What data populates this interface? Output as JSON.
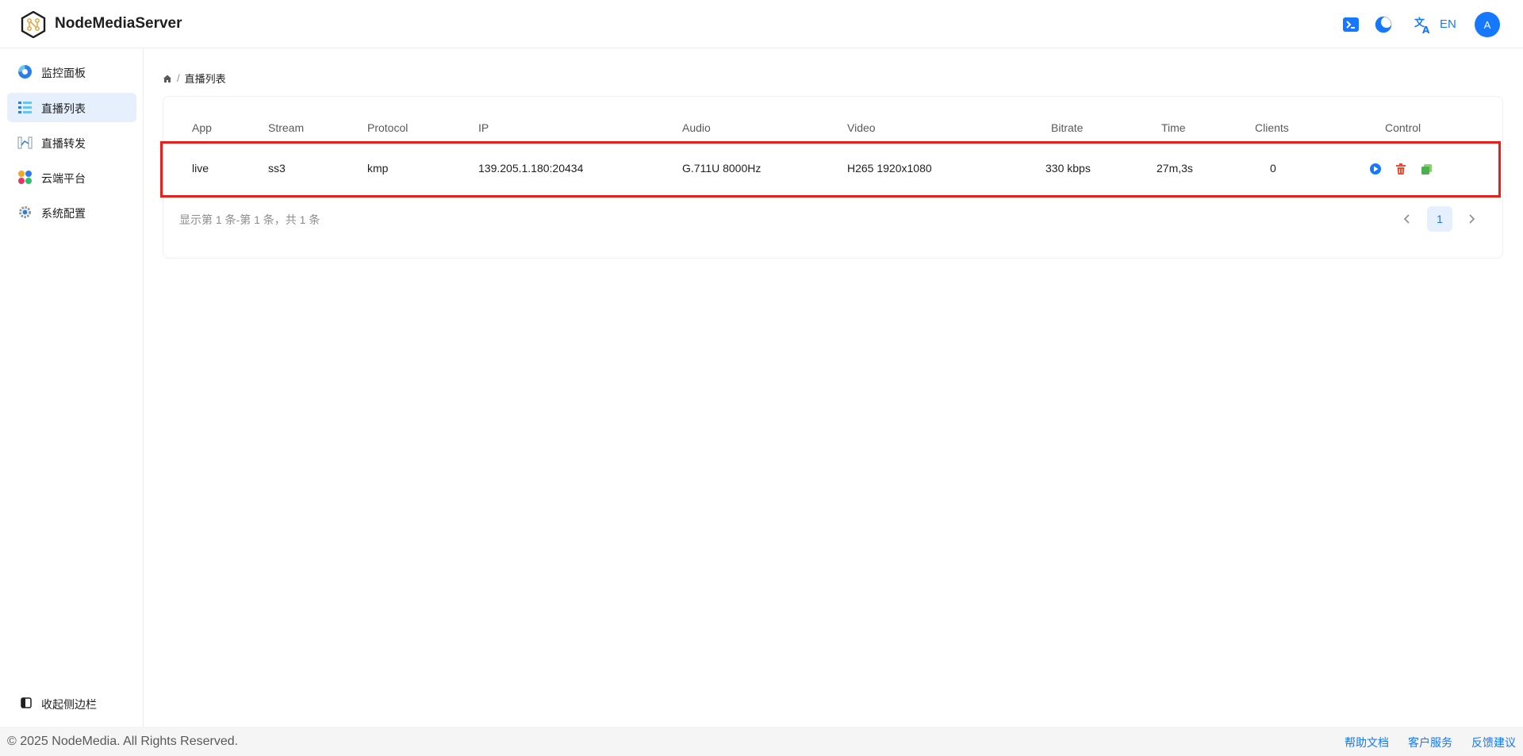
{
  "header": {
    "app_title": "NodeMediaServer",
    "lang": "EN",
    "avatar_initial": "A",
    "accent": "#1677ff"
  },
  "sidebar": {
    "items": [
      {
        "label": "监控面板",
        "icon": "dashboard-icon"
      },
      {
        "label": "直播列表",
        "icon": "list-icon",
        "active": true
      },
      {
        "label": "直播转发",
        "icon": "relay-icon"
      },
      {
        "label": "云端平台",
        "icon": "cloud-platform-icon"
      },
      {
        "label": "系统配置",
        "icon": "settings-icon"
      }
    ],
    "collapse_label": "收起侧边栏"
  },
  "breadcrumb": {
    "current": "直播列表",
    "separator": "/"
  },
  "table": {
    "columns": [
      "App",
      "Stream",
      "Protocol",
      "IP",
      "Audio",
      "Video",
      "Bitrate",
      "Time",
      "Clients",
      "Control"
    ],
    "rows": [
      {
        "app": "live",
        "stream": "ss3",
        "protocol": "kmp",
        "ip": "139.205.1.180:20434",
        "audio": "G.711U 8000Hz",
        "video": "H265 1920x1080",
        "bitrate": "330 kbps",
        "time": "27m,3s",
        "clients": "0"
      }
    ],
    "highlight_color": "#e8201a"
  },
  "pagination": {
    "summary": "显示第 1 条-第 1 条，共 1 条",
    "current_page": "1"
  },
  "footer": {
    "copyright": "© 2025 NodeMedia. All Rights Reserved.",
    "links": [
      "帮助文档",
      "客户服务",
      "反馈建议"
    ]
  }
}
